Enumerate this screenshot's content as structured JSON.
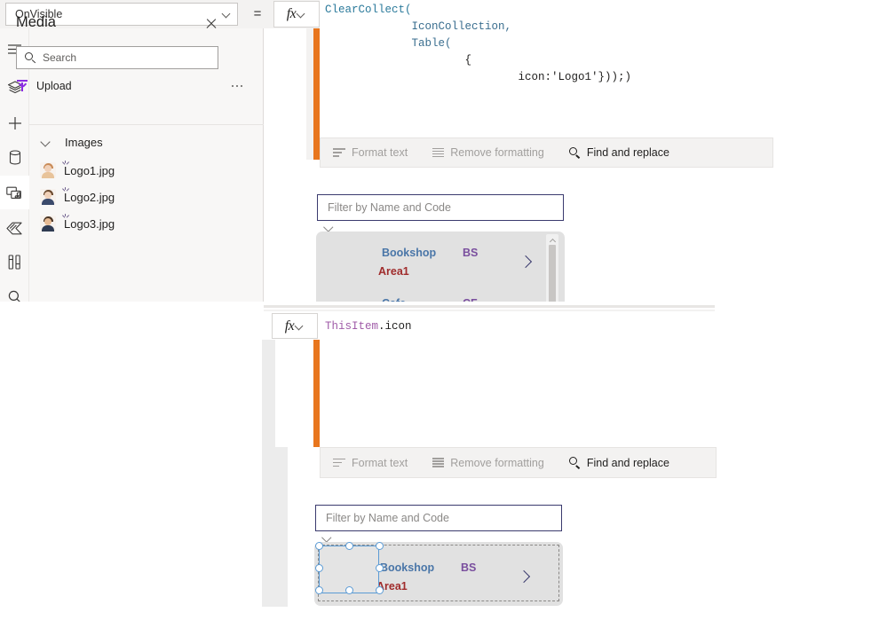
{
  "top_bar": {
    "property_selected": "OnVisible",
    "equals_sign": "=",
    "fx_label": "fx",
    "chevron_icon": "chevron-down-icon"
  },
  "formula_editor_top": {
    "lines": [
      {
        "indent": 0,
        "text": "ClearCollect("
      },
      {
        "indent": 13,
        "text": "IconCollection,"
      },
      {
        "indent": 13,
        "text": "Table("
      },
      {
        "indent": 21,
        "text": "{"
      },
      {
        "indent": 29,
        "text": "icon:'Logo1'}));)"
      }
    ],
    "full_text": "ClearCollect(\n             IconCollection,\n             Table(\n                     {\n                             icon:'Logo1'}));)"
  },
  "formula_editor_bottom": {
    "expr_object": "ThisItem",
    "expr_property": ".icon",
    "full_text": "ThisItem.icon",
    "fx_label": "fx"
  },
  "format_toolbar": {
    "format_text": "Format text",
    "remove_formatting": "Remove formatting",
    "find_and_replace": "Find and replace"
  },
  "rail": {
    "items": [
      {
        "name": "hamburger-menu-icon",
        "selected": false
      },
      {
        "name": "tree-view-icon",
        "selected": false
      },
      {
        "name": "insert-plus-icon",
        "selected": false
      },
      {
        "name": "data-icon",
        "selected": false
      },
      {
        "name": "media-icon",
        "selected": true
      },
      {
        "name": "theme-icon",
        "selected": false
      },
      {
        "name": "variables-icon",
        "selected": false
      },
      {
        "name": "search-icon",
        "selected": false
      }
    ]
  },
  "media_panel": {
    "title": "Media",
    "close_icon": "close-icon",
    "search_placeholder": "Search",
    "search_value": "",
    "upload_label": "Upload",
    "more_icon": "more-options-icon",
    "folder": {
      "label": "Images",
      "expanded": true
    },
    "files": [
      {
        "name": "Logo1.jpg",
        "hair": "#c98b58",
        "skin": "#f0d0b8",
        "body": "#e8c39a"
      },
      {
        "name": "Logo2.jpg",
        "hair": "#6b4a2f",
        "skin": "#f0d0b8",
        "body": "#3b4a6b"
      },
      {
        "name": "Logo3.jpg",
        "hair": "#4a3525",
        "skin": "#e7bb94",
        "body": "#2f3b52"
      }
    ]
  },
  "gallery_top": {
    "filter_placeholder": "Filter by Name and Code",
    "filter_value": "",
    "error_icon": "error-badge-icon",
    "expand_icon": "chevron-down-icon",
    "scrollbar": true,
    "rows": [
      {
        "name": "Bookshop",
        "code": "BS",
        "area": "Area1",
        "arrow": "chevron-right-icon"
      },
      {
        "name": "Cafe",
        "code": "CF",
        "area": "",
        "arrow": "chevron-right-icon"
      }
    ]
  },
  "gallery_bottom": {
    "filter_placeholder": "Filter by Name and Code",
    "filter_value": "",
    "error_icon": "error-badge-icon",
    "expand_icon": "chevron-down-icon",
    "selected_control": "image-control",
    "rows": [
      {
        "name": "Bookshop",
        "code": "BS",
        "area": "Area1",
        "arrow": "chevron-right-icon"
      }
    ]
  },
  "colors": {
    "accent_orange": "#e8761e",
    "gallery_name": "#4a76a8",
    "gallery_code": "#7a4f9e",
    "gallery_area": "#a02c2c",
    "error_red": "#d32f2f",
    "selection_blue": "#5b9bd5",
    "upload_purple": "#8a2be2",
    "focus_border": "#3a3a6e"
  }
}
